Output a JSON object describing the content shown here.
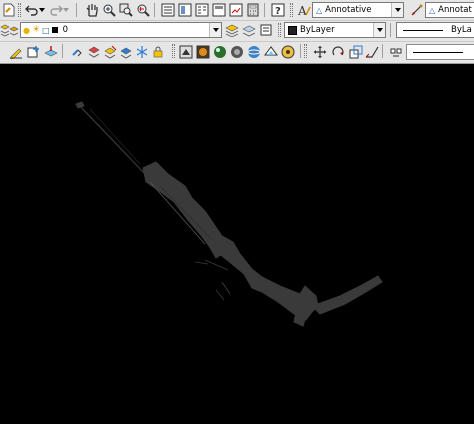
{
  "toolbar_row1": {
    "text_style": "Annotative",
    "dim_style": "Annotat",
    "icons": [
      "undo-icon",
      "redo-icon",
      "pan-icon",
      "zoom-realtime-icon",
      "zoom-window-icon",
      "zoom-previous-icon",
      "properties-icon",
      "design-center-icon",
      "tool-palettes-icon",
      "sheet-set-icon",
      "markup-icon",
      "calculator-icon",
      "help-icon",
      "text-style-icon",
      "dim-style-icon"
    ]
  },
  "toolbar_row2": {
    "layer_name": "0",
    "color_value": "ByLayer",
    "linetype_value": "ByLa"
  },
  "toolbar_row3": {
    "icons": [
      "layer-properties-icon",
      "make-current-icon",
      "layer-previous-icon",
      "render-icon",
      "materials-icon",
      "lights-icon",
      "sun-icon",
      "orbit-icon",
      "visual-style-icon",
      "camera-icon"
    ]
  },
  "colors": {
    "toolbar_bg": "#e6e6e6",
    "canvas_bg": "#000000",
    "geometry": "#3c3c3c"
  }
}
